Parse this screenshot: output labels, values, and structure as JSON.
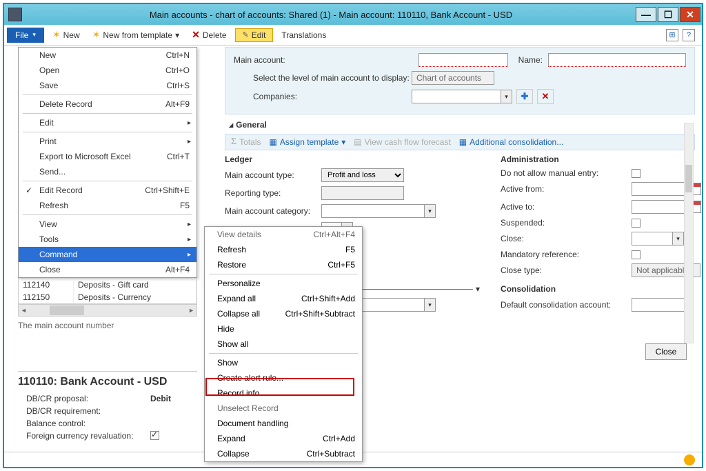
{
  "title": "Main accounts - chart of accounts: Shared (1) - Main account: 110110, Bank Account - USD",
  "toolbar": {
    "file": "File",
    "new": "New",
    "new_tpl": "New from template",
    "new_tpl_arrow": "▾",
    "delete": "Delete",
    "edit": "Edit",
    "translations": "Translations"
  },
  "file_menu": [
    {
      "label": "New",
      "sc": "Ctrl+N"
    },
    {
      "label": "Open",
      "sc": "Ctrl+O"
    },
    {
      "label": "Save",
      "sc": "Ctrl+S"
    },
    {
      "sep": true
    },
    {
      "label": "Delete Record",
      "sc": "Alt+F9"
    },
    {
      "sep": true
    },
    {
      "label": "Edit",
      "sub": true
    },
    {
      "sep": true
    },
    {
      "label": "Print",
      "sub": true
    },
    {
      "label": "Export to Microsoft Excel",
      "sc": "Ctrl+T"
    },
    {
      "label": "Send..."
    },
    {
      "sep": true
    },
    {
      "label": "Edit Record",
      "sc": "Ctrl+Shift+E",
      "check": true
    },
    {
      "label": "Refresh",
      "sc": "F5"
    },
    {
      "sep": true
    },
    {
      "label": "View",
      "sub": true
    },
    {
      "label": "Tools",
      "sub": true
    },
    {
      "label": "Command",
      "sub": true,
      "hl": true
    },
    {
      "label": "Close",
      "sc": "Alt+F4"
    }
  ],
  "grid_rows": [
    {
      "id": "112140",
      "name": "Deposits - Gift card"
    },
    {
      "id": "112150",
      "name": "Deposits - Currency"
    }
  ],
  "status_hint": "The main account number",
  "detail": {
    "title": "110110: Bank Account - USD",
    "dbcr_prop_lbl": "DB/CR proposal:",
    "dbcr_prop_val": "Debit",
    "dbcr_req_lbl": "DB/CR requirement:",
    "bal_lbl": "Balance control:",
    "fx_lbl": "Foreign currency revaluation:",
    "fx_checked": true
  },
  "ctx_menu": [
    {
      "label": "View details",
      "sc": "Ctrl+Alt+F4"
    },
    {
      "label": "Refresh",
      "sc": "F5",
      "en": true
    },
    {
      "label": "Restore",
      "sc": "Ctrl+F5",
      "en": true
    },
    {
      "sep": true
    },
    {
      "label": "Personalize",
      "en": true
    },
    {
      "label": "Expand all",
      "sc": "Ctrl+Shift+Add",
      "en": true
    },
    {
      "label": "Collapse all",
      "sc": "Ctrl+Shift+Subtract",
      "en": true
    },
    {
      "label": "Hide",
      "en": true
    },
    {
      "label": "Show all",
      "en": true
    },
    {
      "sep": true
    },
    {
      "label": "Show",
      "en": true
    },
    {
      "label": "Create alert rule...",
      "en": true
    },
    {
      "label": "Record info",
      "en": true
    },
    {
      "label": "Unselect Record"
    },
    {
      "label": "Document handling",
      "en": true
    },
    {
      "label": "Expand",
      "sc": "Ctrl+Add",
      "en": true
    },
    {
      "label": "Collapse",
      "sc": "Ctrl+Subtract",
      "en": true
    }
  ],
  "form": {
    "main_account_lbl": "Main account:",
    "name_lbl": "Name:",
    "level_lbl": "Select the level of main account to display:",
    "level_val": "Chart of accounts",
    "companies_lbl": "Companies:",
    "section_general": "General",
    "actions": {
      "totals": "Totals",
      "assign_tpl": "Assign template",
      "cashflow": "View cash flow forecast",
      "consol": "Additional consolidation..."
    },
    "ledger": {
      "hdr": "Ledger",
      "type_lbl": "Main account type:",
      "type_val": "Profit and loss",
      "rep_lbl": "Reporting type:",
      "cat_lbl": "Main account category:"
    },
    "admin": {
      "hdr": "Administration",
      "no_manual": "Do not allow manual entry:",
      "active_from": "Active from:",
      "active_to": "Active to:",
      "suspended": "Suspended:",
      "close": "Close:",
      "mandatory": "Mandatory reference:",
      "close_type": "Close type:",
      "close_type_val": "Not applicable"
    },
    "consol_section": "Consolidation",
    "consol_lbl": "Default consolidation account:",
    "close_btn": "Close"
  }
}
